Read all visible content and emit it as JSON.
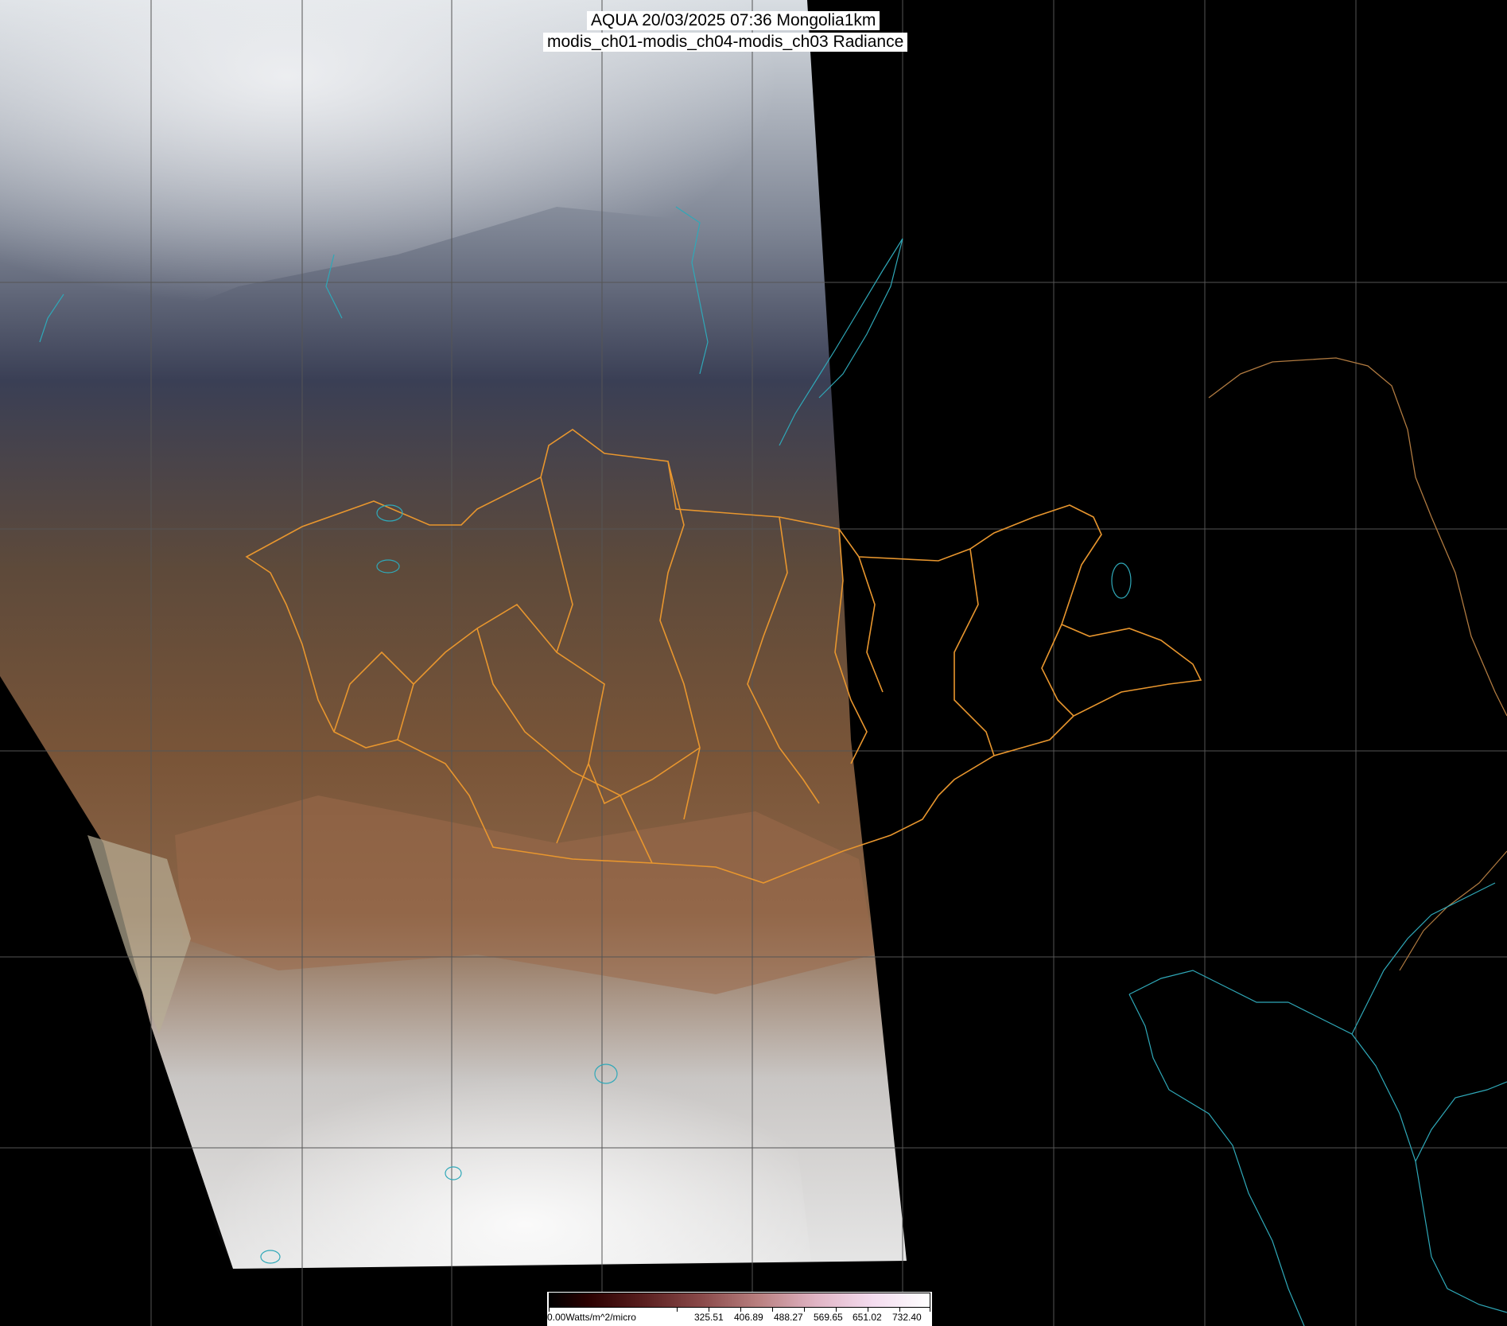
{
  "title": {
    "line1": "AQUA 20/03/2025 07:36 Mongolia1km",
    "line2": "modis_ch01-modis_ch04-modis_ch03 Radiance"
  },
  "colorbar": {
    "first_label": "0.00Watts/m^2/micro",
    "labels": [
      "325.51",
      "406.89",
      "488.27",
      "569.65",
      "651.02",
      "732.40"
    ]
  },
  "colors": {
    "background": "#000000",
    "borders": "#e8962e",
    "coastline": "#2fa8b8",
    "grid": "#555555"
  }
}
